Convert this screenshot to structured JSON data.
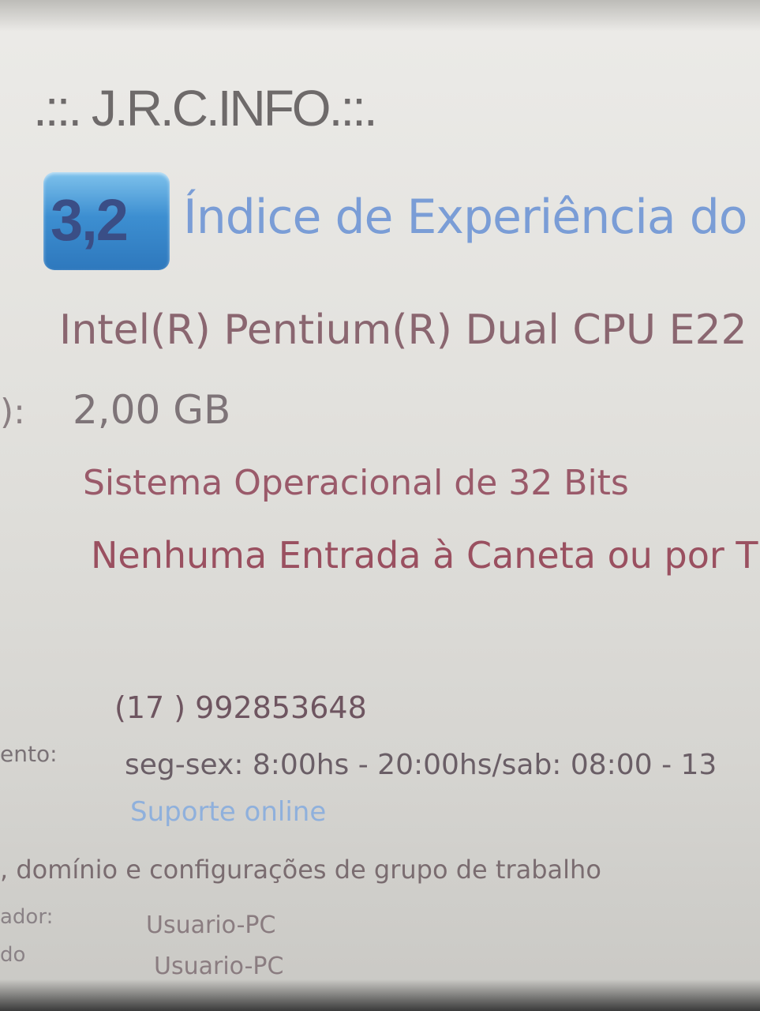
{
  "system": {
    "manufacturer": ".::. J.R.C.INFO.::.",
    "rating": {
      "score": "3,2",
      "link_label": "Índice de Experiência do W"
    },
    "processor": "Intel(R) Pentium(R) Dual  CPU  E22",
    "ram_label": "):",
    "ram": "2,00 GB",
    "system_type": "Sistema Operacional de 32 Bits",
    "pen_touch": "Nenhuma Entrada à Caneta ou por T"
  },
  "support": {
    "phone": "(17 ) 992853648",
    "hours_label": "ento:",
    "hours": "seg-sex: 8:00hs - 20:00hs/sab: 08:00 - 13",
    "online_link": "Suporte online"
  },
  "computer_name": {
    "heading": ", domínio e configurações de grupo de trabalho",
    "computer_label": "ador:",
    "computer_value": "Usuario-PC",
    "full_label": "do",
    "full_value": "Usuario-PC"
  },
  "colors": {
    "badge_blue": "#3d8fd1",
    "link_blue": "#7a9dd6"
  }
}
